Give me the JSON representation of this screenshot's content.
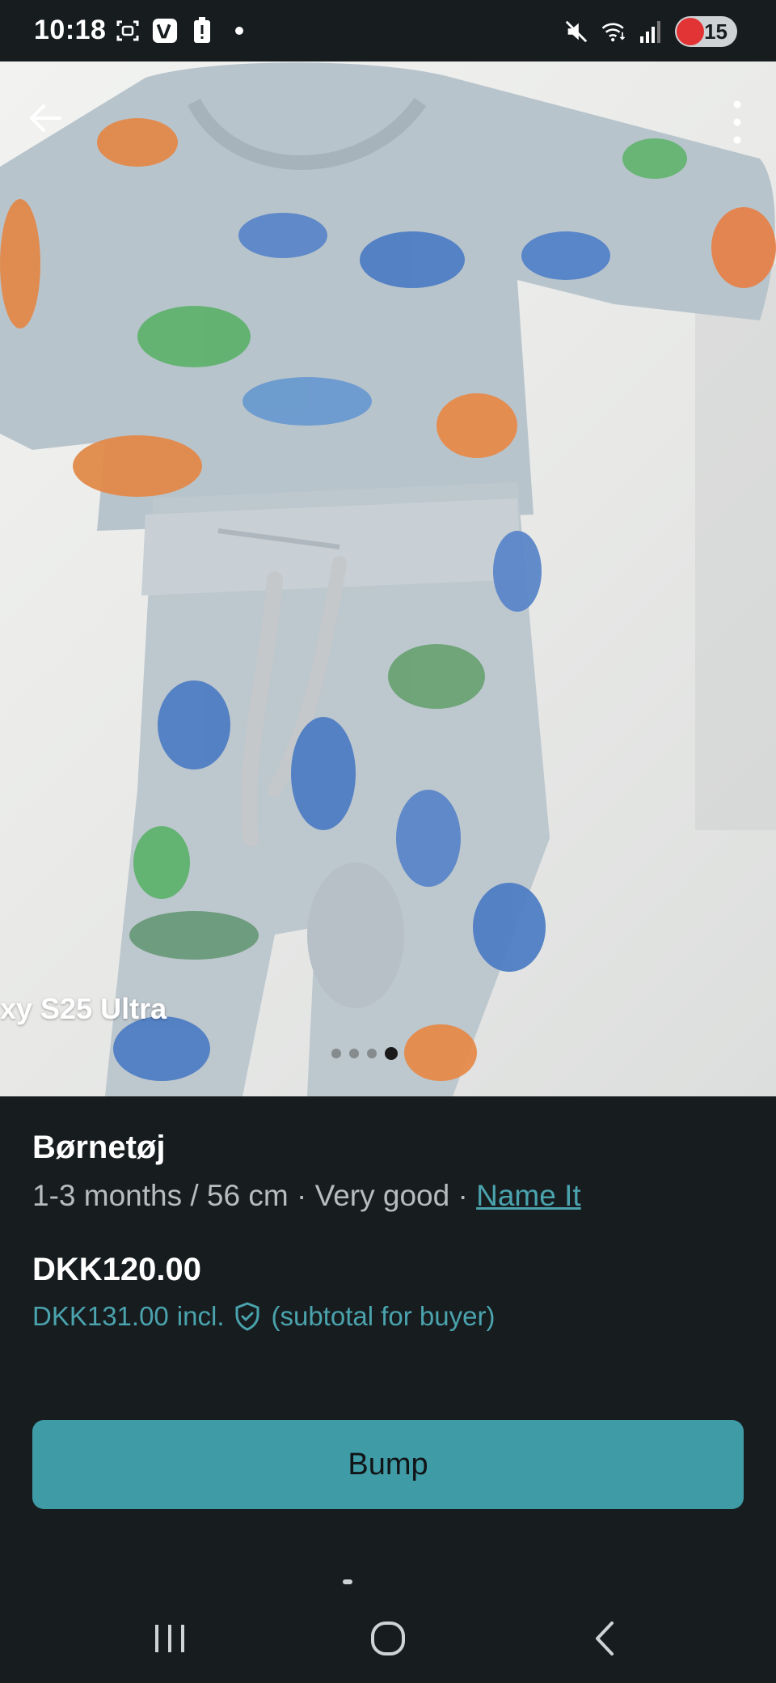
{
  "status_bar": {
    "time": "10:18",
    "battery_level": "15",
    "icons_left": [
      "screenshot-icon",
      "vinted-app-icon",
      "battery-alert-icon",
      "notification-dot-icon"
    ],
    "icons_right": [
      "mute-icon",
      "wifi-icon",
      "signal-icon",
      "battery-icon"
    ]
  },
  "photo": {
    "watermark": "xy S25 Ultra",
    "image_count": 4,
    "active_image_index": 4
  },
  "listing": {
    "title": "Børnetøj",
    "size": "1-3 months / 56 cm",
    "separator": " · ",
    "condition": "Very good",
    "brand": "Name It",
    "price": "DKK120.00",
    "buyer_price": "DKK131.00",
    "buyer_price_incl": "incl.",
    "buyer_price_note": "(subtotal for buyer)"
  },
  "actions": {
    "bump_label": "Bump"
  },
  "colors": {
    "accent": "#3f9ba5",
    "link": "#4aa3ad",
    "background": "#171c1f"
  }
}
